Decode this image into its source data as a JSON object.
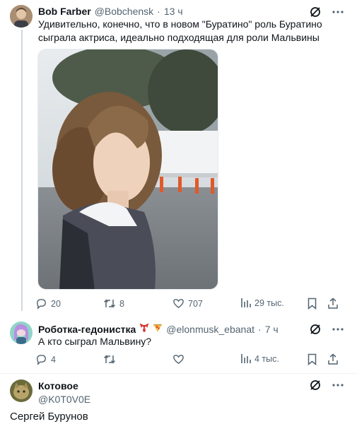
{
  "tweets": [
    {
      "name": "Bob Farber",
      "handle": "@Bobchensk",
      "time": "13 ч",
      "text": "Удивительно, конечно, что в новом \"Буратино\" роль Буратино сыграла актриса, идеально подходящая для роли Мальвины",
      "actions": {
        "replies": "20",
        "reposts": "8",
        "likes": "707",
        "views": "29 тыс."
      }
    },
    {
      "name": "Роботка-гедонистка",
      "handle": "@elonmusk_ebanat",
      "time": "7 ч",
      "text": "А кто сыграл Мальвину?",
      "actions": {
        "replies": "4",
        "reposts": "",
        "likes": "",
        "views": "4 тыс."
      }
    },
    {
      "name": "Котовое",
      "handle": "@K0T0V0E",
      "text": "Сергей Бурунов"
    }
  ],
  "icons": {
    "grok": "grok-icon",
    "more": "more-icon",
    "reply": "reply-icon",
    "repost": "repost-icon",
    "like": "like-icon",
    "views": "views-icon",
    "bookmark": "bookmark-icon",
    "share": "share-icon"
  },
  "colors": {
    "text": "#0f1419",
    "secondary": "#536471",
    "thread_line": "#cfd9de"
  }
}
